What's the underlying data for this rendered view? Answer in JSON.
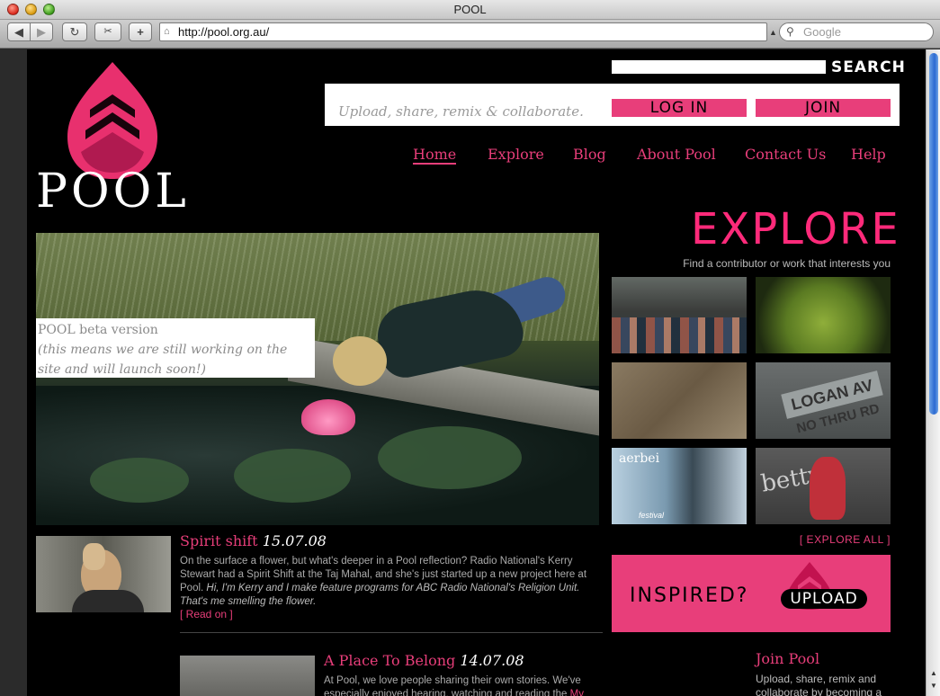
{
  "window": {
    "title": "POOL"
  },
  "toolbar": {
    "back": "◀",
    "forward": "▶",
    "reload": "↻",
    "snapshot": "✂",
    "add_bookmark": "+",
    "url": "http://pool.org.au/",
    "search_placeholder": "Google"
  },
  "header": {
    "logo_word": "POOL",
    "search_button": "SEARCH",
    "search_value": "",
    "tagline": "Upload, share, remix & collaborate.",
    "login": "LOG IN",
    "join": "JOIN"
  },
  "nav": [
    {
      "label": "Home",
      "active": true
    },
    {
      "label": "Explore"
    },
    {
      "label": "Blog"
    },
    {
      "label": "About Pool"
    },
    {
      "label": "Contact Us"
    },
    {
      "label": "Help"
    }
  ],
  "hero": {
    "beta_line1": "POOL beta version",
    "beta_line2": "(this means we are still working on the site and will launch soon!)"
  },
  "explore": {
    "heading": "EXPLORE",
    "subheading": "Find a contributor or work that interests you",
    "explore_all": "[ EXPLORE ALL ]",
    "thumb_sign": "LOGAN AV",
    "thumb_sign_small": "NO THRU RD",
    "thumb_vertical": "aerbei",
    "thumb_festival": "festival",
    "thumb_graffiti": "betty"
  },
  "promo": {
    "inspired": "INSPIRED?",
    "upload": "UPLOAD"
  },
  "posts": [
    {
      "title": "Spirit shift",
      "date": "15.07.08",
      "body": "On the surface a flower, but what's deeper in a Pool reflection? Radio National's Kerry Stewart had a Spirit Shift at the Taj Mahal, and she's just started up a new project here at Pool.",
      "body_italic": "Hi, I'm Kerry and I make feature programs for ABC Radio National's Religion Unit. That's me smelling the flower.",
      "read_on": "[ Read on ]"
    },
    {
      "title": "A Place To Belong",
      "date": "14.07.08",
      "body": "At Pool, we love people sharing their own stories. We've especially enjoyed hearing, watching and reading the",
      "body_link": "My"
    }
  ],
  "join_pool": {
    "heading": "Join Pool",
    "body": "Upload, share, remix and collaborate by becoming a"
  },
  "colors": {
    "accent": "#e83e7a",
    "background": "#000000"
  }
}
